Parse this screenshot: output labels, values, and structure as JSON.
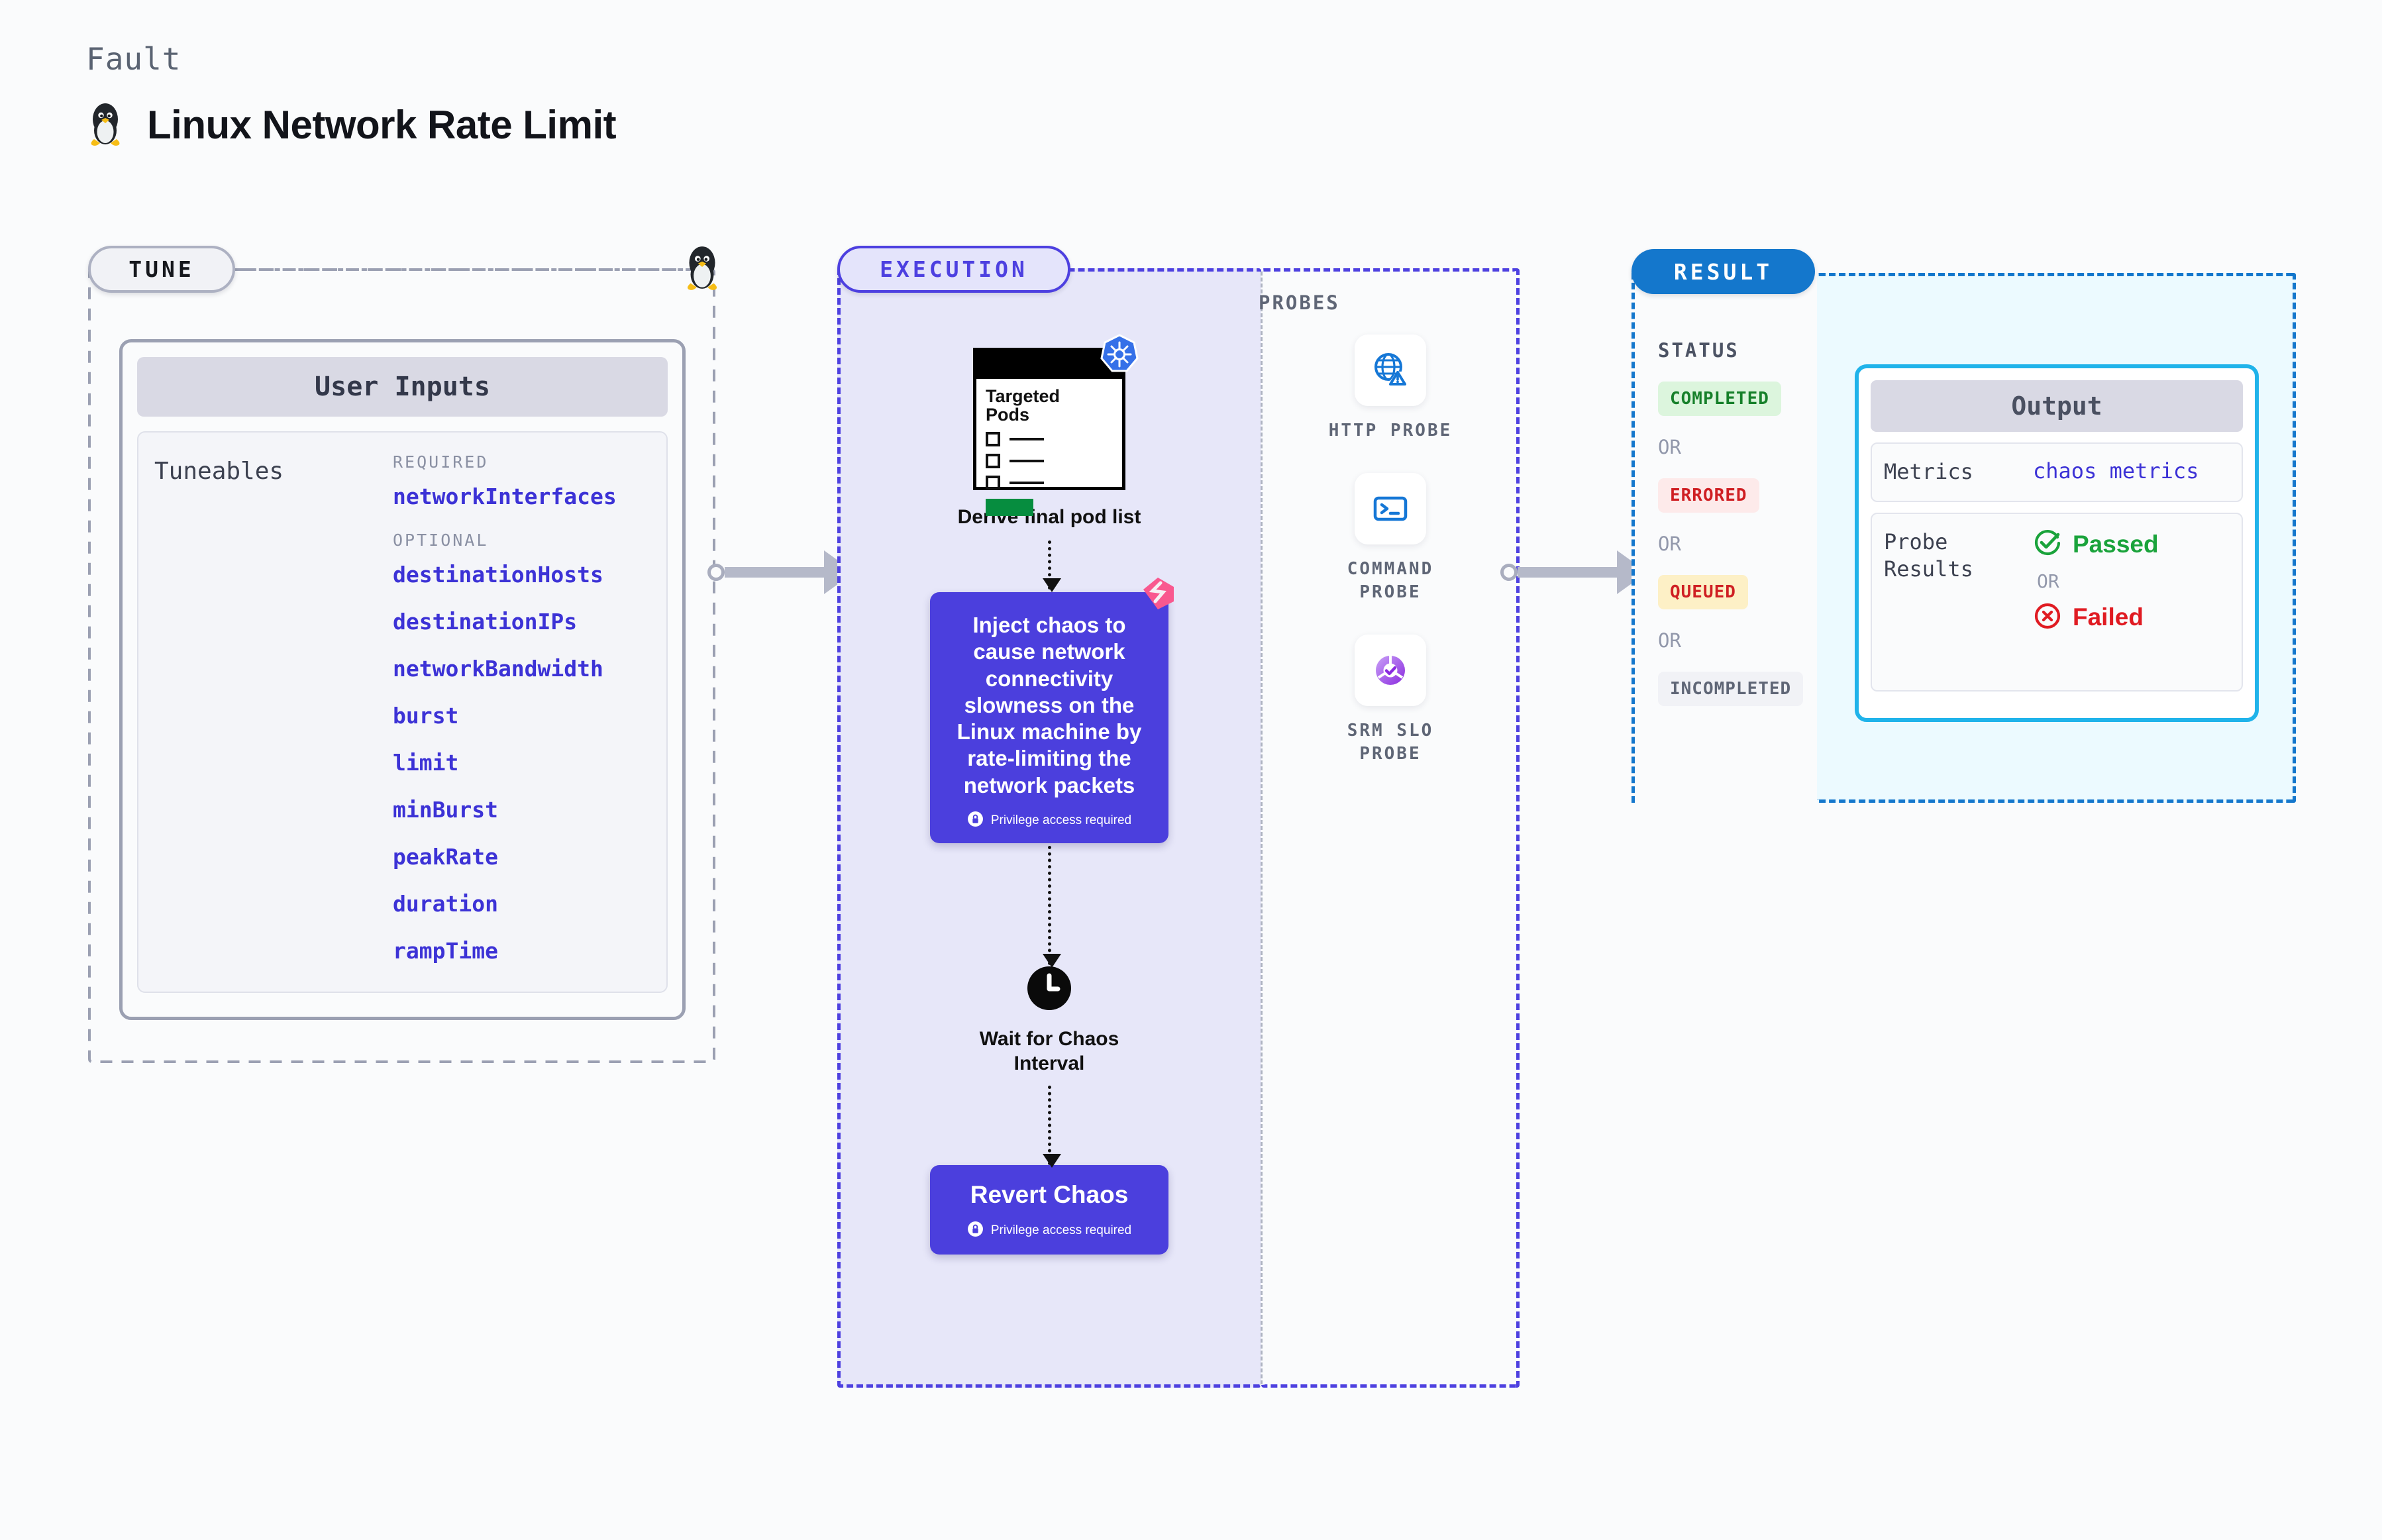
{
  "header": {
    "kind_label": "Fault",
    "title": "Linux Network Rate Limit",
    "icon": "tux-penguin-icon"
  },
  "sections": {
    "tune": {
      "pill_label": "TUNE"
    },
    "execution": {
      "pill_label": "EXECUTION"
    },
    "probes": {
      "label": "PROBES"
    },
    "result": {
      "pill_label": "RESULT"
    }
  },
  "tune": {
    "card_header": "User Inputs",
    "tuneables_label": "Tuneables",
    "required_label": "REQUIRED",
    "optional_label": "OPTIONAL",
    "required": [
      "networkInterfaces"
    ],
    "optional": [
      "destinationHosts",
      "destinationIPs",
      "networkBandwidth",
      "burst",
      "limit",
      "minBurst",
      "peakRate",
      "duration",
      "rampTime"
    ]
  },
  "execution": {
    "pod_card": {
      "title_line1": "Targeted",
      "title_line2": "Pods",
      "badge_icon": "kubernetes-icon"
    },
    "derive_label": "Derive final pod list",
    "chaos": {
      "text": "Inject chaos to cause network connectivity slowness on the Linux machine by rate-limiting the network packets",
      "privilege_note": "Privilege access required",
      "corner_icon": "litmuschaos-icon",
      "lock_icon": "lock-icon"
    },
    "wait": {
      "icon": "clock-icon",
      "label_line1": "Wait for Chaos",
      "label_line2": "Interval"
    },
    "revert": {
      "title": "Revert Chaos",
      "privilege_note": "Privilege access required",
      "lock_icon": "lock-icon"
    }
  },
  "probes": [
    {
      "icon": "globe-warning-icon",
      "label_line1": "HTTP  PROBE",
      "label_line2": ""
    },
    {
      "icon": "terminal-icon",
      "label_line1": "COMMAND",
      "label_line2": "PROBE"
    },
    {
      "icon": "slo-donut-check-icon",
      "label_line1": "SRM  SLO",
      "label_line2": "PROBE"
    }
  ],
  "result": {
    "status_title": "STATUS",
    "or_label": "OR",
    "statuses": [
      {
        "label": "COMPLETED",
        "bg": "#dcf5dd",
        "fg": "#16802a"
      },
      {
        "label": "ERRORED",
        "bg": "#fdeaea",
        "fg": "#cf1f23"
      },
      {
        "label": "QUEUED",
        "bg": "#fdf0c6",
        "fg": "#cf1f23"
      },
      {
        "label": "INCOMPLETED",
        "bg": "#f1f2f6",
        "fg": "#5f6676"
      }
    ],
    "output": {
      "header": "Output",
      "metrics_key": "Metrics",
      "metrics_value": "chaos metrics",
      "probe_results_key_line1": "Probe",
      "probe_results_key_line2": "Results",
      "passed_label": "Passed",
      "failed_label": "Failed",
      "or_label": "OR",
      "passed_icon": "check-circle-icon",
      "failed_icon": "x-circle-icon"
    }
  },
  "colors": {
    "execution_accent": "#4d40e0",
    "result_accent": "#1477cc",
    "output_border": "#20b3ea",
    "chaos_box": "#4b3fdd",
    "tuneable_text": "#3c32d6",
    "passed": "#1aa33b",
    "failed": "#e01b22"
  }
}
